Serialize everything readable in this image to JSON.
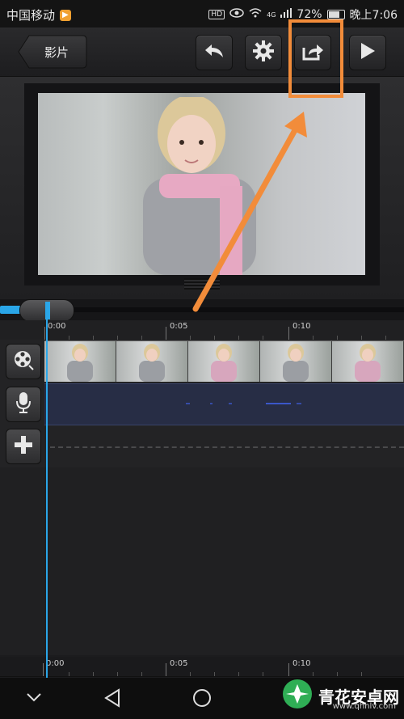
{
  "status_bar": {
    "carrier": "中国移动",
    "carrier_badge": "▶",
    "hd": "HD",
    "network": "4G",
    "battery": "72%",
    "time": "晚上7:06"
  },
  "toolbar": {
    "back_label": "影片",
    "undo_icon": "undo-icon",
    "settings_icon": "gear-icon",
    "share_icon": "share-export-icon",
    "play_icon": "play-icon"
  },
  "timeline": {
    "ruler_labels": [
      "0:00",
      "0:05",
      "0:10"
    ],
    "track_icons": [
      "film-reel-icon",
      "microphone-icon",
      "plus-icon"
    ]
  },
  "colors": {
    "accent_blue": "#2aa6e8",
    "annotation_orange": "#f28c3a",
    "audio_track": "#272d45"
  },
  "watermark": {
    "text": "青花安卓网",
    "url": "www.qhhlv.com"
  }
}
